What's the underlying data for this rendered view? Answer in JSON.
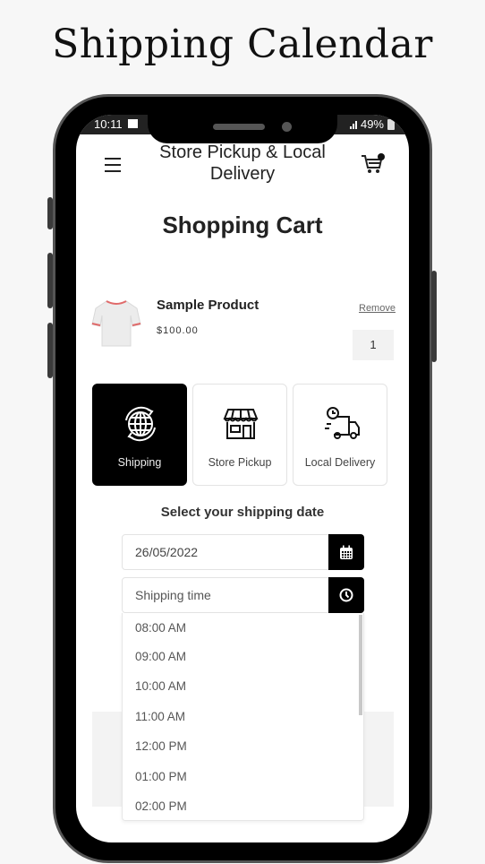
{
  "headline": "Shipping Calendar",
  "status_bar": {
    "time": "10:11",
    "battery": "49%"
  },
  "header": {
    "menu_icon": "hamburger-icon",
    "store_title": "Store Pickup & Local Delivery",
    "cart_icon": "cart-icon"
  },
  "page_title": "Shopping Cart",
  "cart_item": {
    "name": "Sample Product",
    "price": "$100.00",
    "remove_label": "Remove",
    "quantity": "1"
  },
  "delivery_methods": [
    {
      "label": "Shipping",
      "icon": "globe-sync-icon",
      "selected": true
    },
    {
      "label": "Store Pickup",
      "icon": "storefront-icon",
      "selected": false
    },
    {
      "label": "Local Delivery",
      "icon": "delivery-truck-clock-icon",
      "selected": false
    }
  ],
  "shipping_date": {
    "label": "Select your shipping date",
    "value": "26/05/2022",
    "button_icon": "calendar-icon"
  },
  "shipping_time": {
    "placeholder": "Shipping time",
    "button_icon": "clock-icon",
    "options": [
      "08:00 AM",
      "09:00 AM",
      "10:00 AM",
      "11:00 AM",
      "12:00 PM",
      "01:00 PM",
      "02:00 PM"
    ]
  }
}
